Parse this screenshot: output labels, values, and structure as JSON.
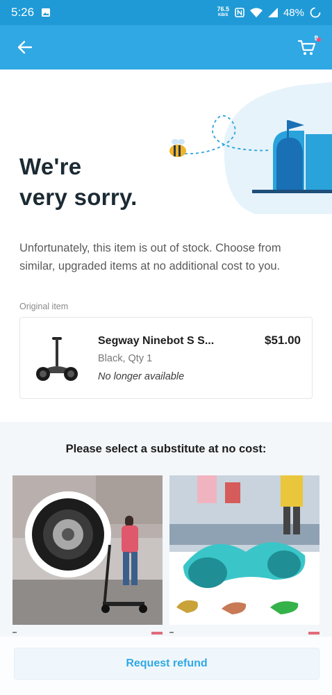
{
  "status_bar": {
    "time": "5:26",
    "net_speed_value": "76.5",
    "net_speed_unit": "KB/S",
    "battery": "48%",
    "icons": [
      "image-icon",
      "nfc-icon",
      "wifi-icon",
      "signal-icon",
      "battery-icon"
    ]
  },
  "app_bar": {
    "back_icon": "arrow-left-icon",
    "cart_icon": "cart-icon",
    "cart_count": "9"
  },
  "hero": {
    "title_line1": "We're",
    "title_line2": "very sorry."
  },
  "intro_text": "Unfortunately, this item is out of stock. Choose from similar, upgraded items at no additional cost to you.",
  "original_item": {
    "section_label": "Original item",
    "title": "Segway Ninebot S S...",
    "price": "$51.00",
    "variant": "Black, Qty 1",
    "status": "No longer available"
  },
  "substitutes": {
    "heading": "Please select a substitute at no cost:",
    "items": [
      {
        "image": "electric-scooter-with-wheel-inset"
      },
      {
        "image": "chrome-hoverboards"
      }
    ]
  },
  "refund": {
    "label": "Request refund"
  },
  "colors": {
    "status_bar": "#1f9ad6",
    "app_bar": "#2fa8e4",
    "accent": "#2fa8e4",
    "subs_bg": "#f4f7fa"
  }
}
